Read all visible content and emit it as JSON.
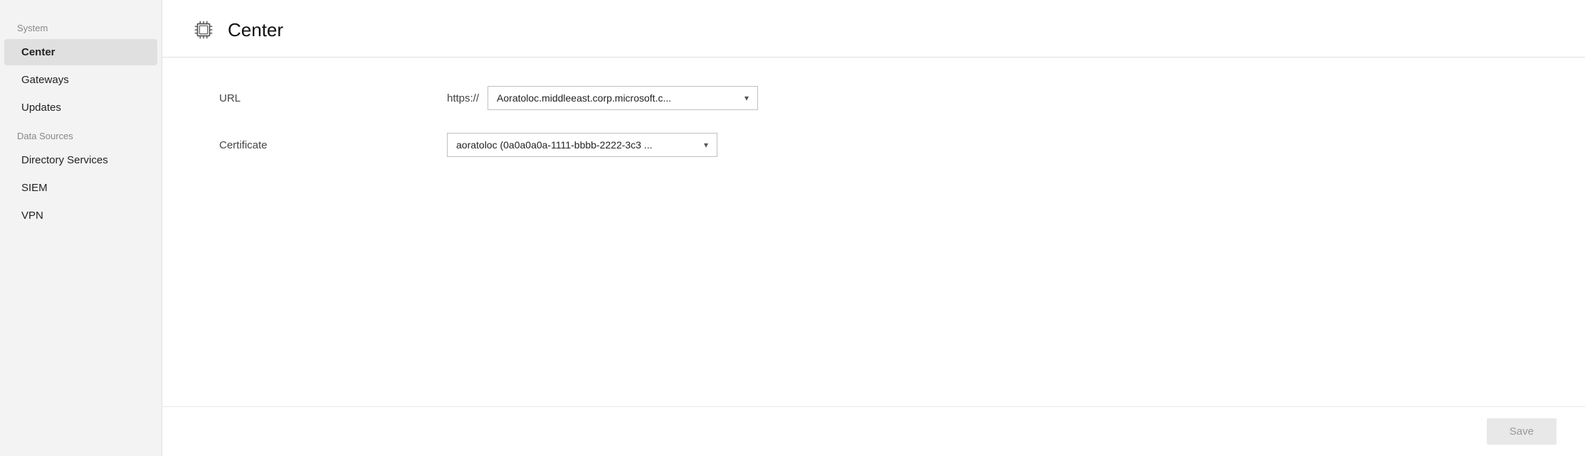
{
  "sidebar": {
    "system_label": "System",
    "data_sources_label": "Data Sources",
    "items": [
      {
        "id": "center",
        "label": "Center",
        "active": true
      },
      {
        "id": "gateways",
        "label": "Gateways",
        "active": false
      },
      {
        "id": "updates",
        "label": "Updates",
        "active": false
      },
      {
        "id": "directory-services",
        "label": "Directory Services",
        "active": false
      },
      {
        "id": "siem",
        "label": "SIEM",
        "active": false
      },
      {
        "id": "vpn",
        "label": "VPN",
        "active": false
      }
    ]
  },
  "page": {
    "title": "Center",
    "icon": "cpu"
  },
  "form": {
    "url_label": "URL",
    "url_prefix": "https://",
    "url_value": "Aoratoloc.middleeast.corp.microsoft.c...",
    "certificate_label": "Certificate",
    "certificate_value": "aoratoloc (0a0a0a0a-1111-bbbb-2222-3c3 ..."
  },
  "footer": {
    "save_label": "Save"
  }
}
